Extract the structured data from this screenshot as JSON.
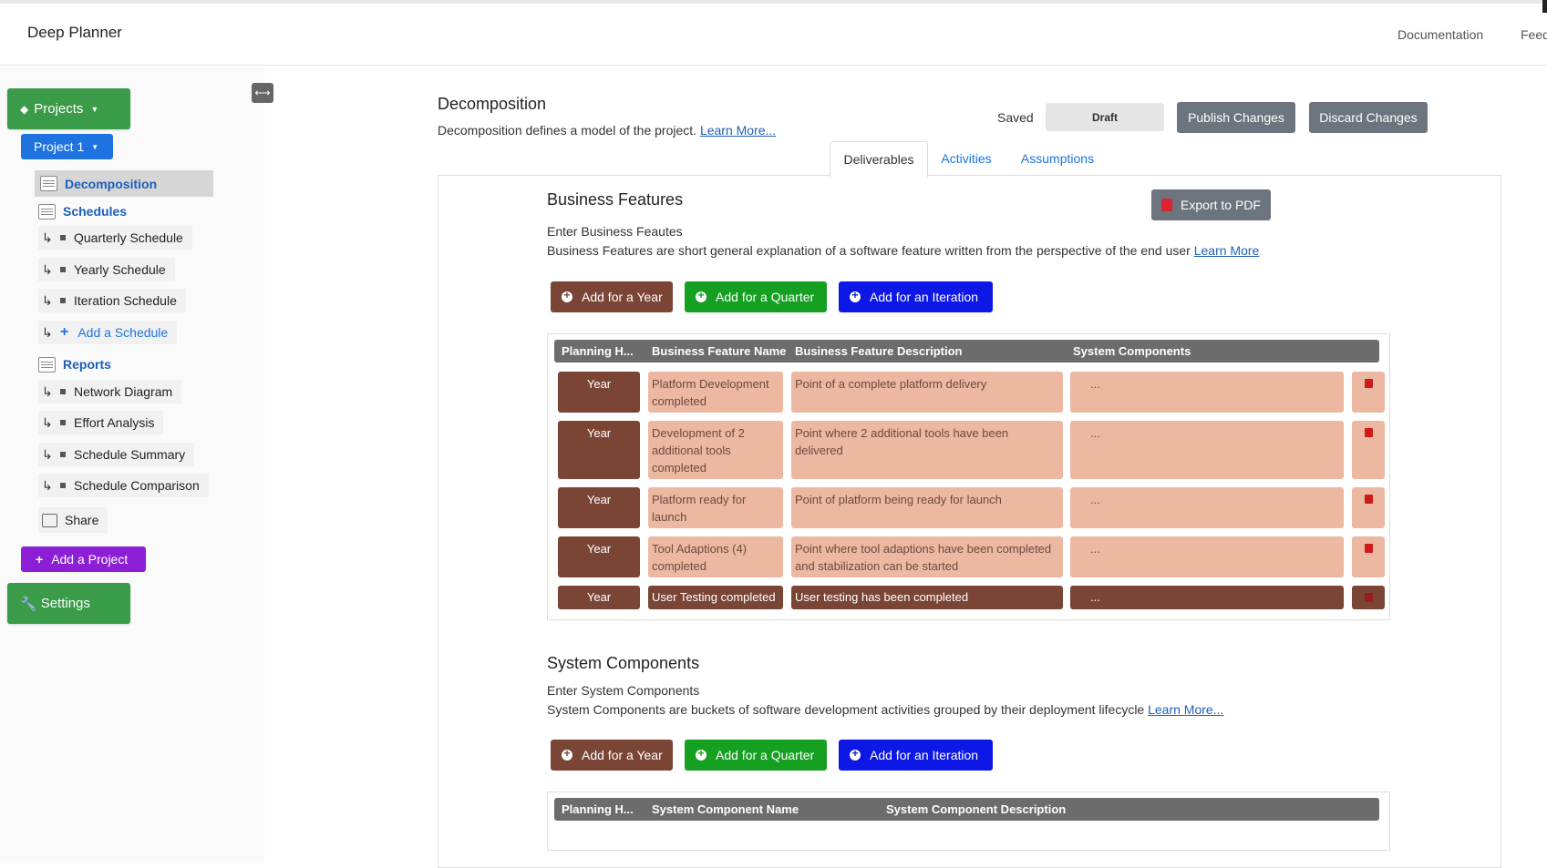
{
  "app": {
    "title": "Deep Planner"
  },
  "nav": {
    "documentation": "Documentation",
    "feedback": "Feedback"
  },
  "sidebar": {
    "projects_label": "Projects",
    "project_label": "Project 1",
    "decomposition": "Decomposition",
    "schedules": "Schedules",
    "schedule_items": [
      "Quarterly Schedule",
      "Yearly Schedule",
      "Iteration Schedule"
    ],
    "add_schedule": "Add a Schedule",
    "reports": "Reports",
    "report_items": [
      "Network Diagram",
      "Effort Analysis",
      "Schedule Summary",
      "Schedule Comparison"
    ],
    "share": "Share",
    "add_project": "Add a Project",
    "settings": "Settings"
  },
  "page": {
    "title": "Decomposition",
    "description": "Decomposition defines a model of the project.",
    "learn_more": "Learn More...",
    "saved_label": "Saved",
    "status": "Draft",
    "publish": "Publish Changes",
    "discard": "Discard Changes"
  },
  "tabs": [
    "Deliverables",
    "Activities",
    "Assumptions"
  ],
  "business_features": {
    "title": "Business Features",
    "subtitle": "Enter Business Feautes",
    "description": "Business Features are short general explanation of a software feature written from the perspective of the end user",
    "learn_more": "Learn More",
    "export": "Export to PDF",
    "buttons": {
      "year": "Add for a Year",
      "quarter": "Add for a Quarter",
      "iteration": "Add for an Iteration"
    },
    "columns": [
      "Planning H...",
      "Business Feature Name",
      "Business Feature Description",
      "System Components"
    ],
    "rows": [
      {
        "horizon": "Year",
        "name": "Platform Development completed",
        "description": "Point of a complete platform delivery",
        "components": "..."
      },
      {
        "horizon": "Year",
        "name": "Development of 2 additional tools completed",
        "description": "Point where 2 additional tools have been delivered",
        "components": "..."
      },
      {
        "horizon": "Year",
        "name": "Platform ready for launch",
        "description": "Point of platform being ready for launch",
        "components": "..."
      },
      {
        "horizon": "Year",
        "name": "Tool Adaptions (4) completed",
        "description": "Point where tool adaptions have been completed and stabilization can be started",
        "components": "..."
      },
      {
        "horizon": "Year",
        "name": "User Testing completed",
        "description": "User testing has been completed",
        "components": "..."
      }
    ]
  },
  "system_components": {
    "title": "System Components",
    "subtitle": "Enter System Components",
    "description": "System Components are buckets of software development activities grouped by their deployment lifecycle",
    "learn_more": "Learn More...",
    "buttons": {
      "year": "Add for a Year",
      "quarter": "Add for a Quarter",
      "iteration": "Add for an Iteration"
    },
    "columns": [
      "Planning H...",
      "System Component Name",
      "System Component Description"
    ]
  }
}
